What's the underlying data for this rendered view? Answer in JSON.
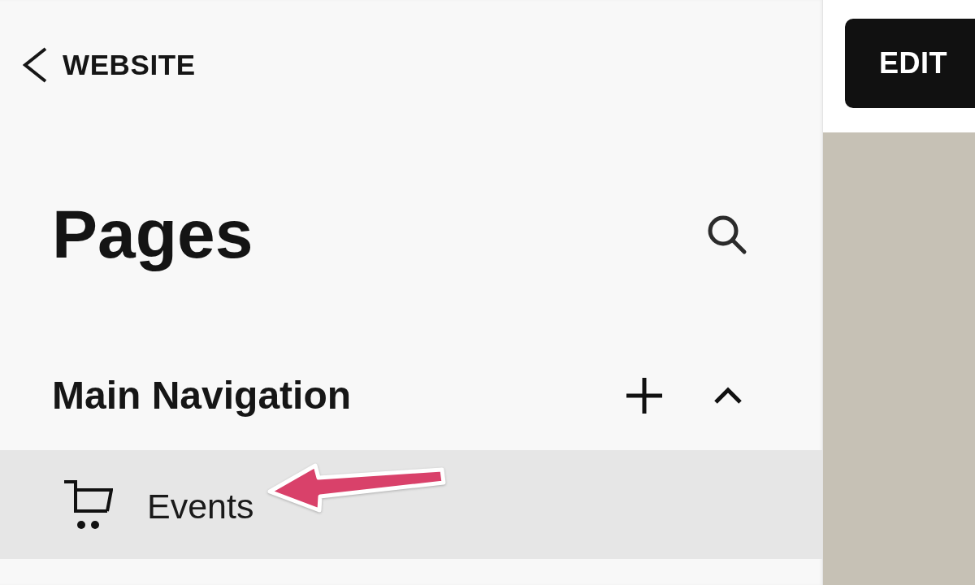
{
  "sidebar": {
    "back_link": "WEBSITE",
    "title": "Pages",
    "navigation": {
      "title": "Main Navigation",
      "expanded": true,
      "items": [
        {
          "label": "Events",
          "selected": true
        }
      ]
    }
  },
  "editor": {
    "edit_button": "EDIT"
  }
}
